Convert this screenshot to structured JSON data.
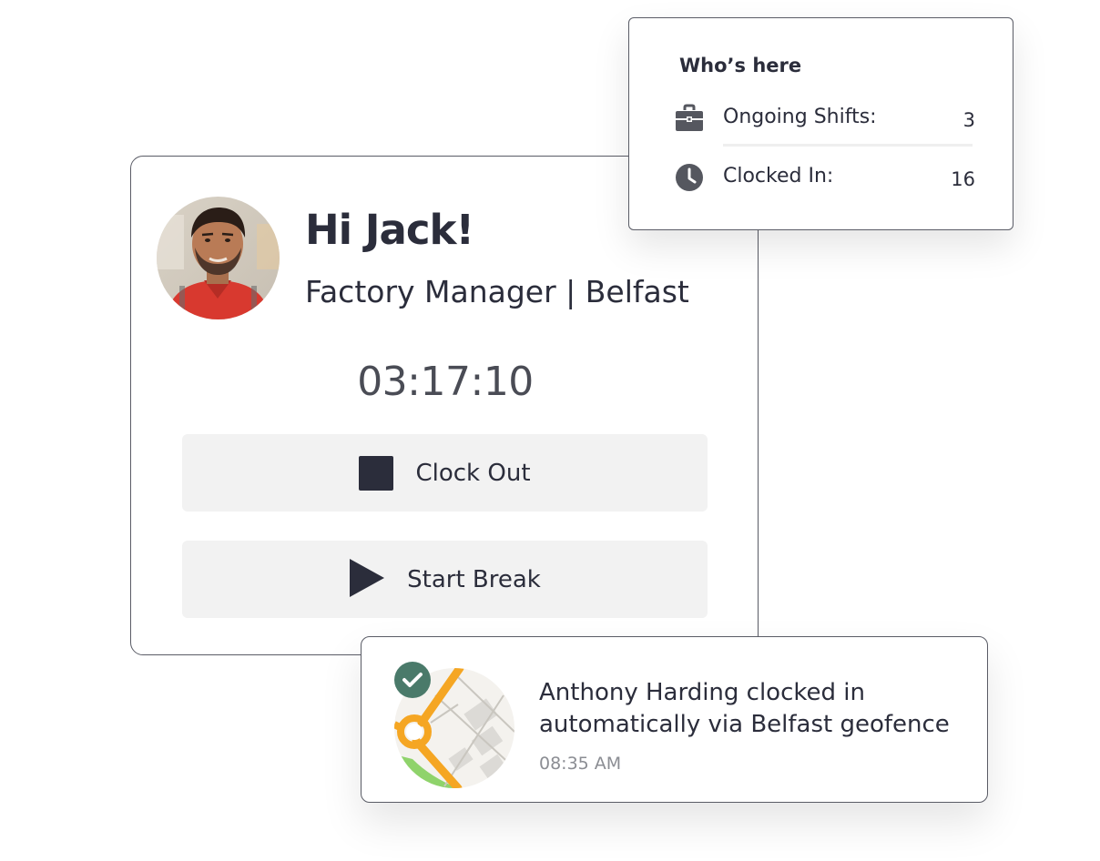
{
  "user": {
    "greeting": "Hi Jack!",
    "role_location": "Factory Manager | Belfast",
    "avatar": "user-photo"
  },
  "timer": {
    "elapsed": "03:17:10"
  },
  "actions": {
    "clock_out_label": "Clock Out",
    "clock_out_icon": "stop-icon",
    "start_break_label": "Start Break",
    "start_break_icon": "play-icon"
  },
  "whos_here": {
    "title": "Who’s here",
    "ongoing_shifts_label": "Ongoing Shifts:",
    "ongoing_shifts_icon": "briefcase-icon",
    "ongoing_shifts_value": "3",
    "clocked_in_label": "Clocked In:",
    "clocked_in_icon": "clock-icon",
    "clocked_in_value": "16"
  },
  "notification": {
    "message": "Anthony Harding clocked in automatically via Belfast geofence",
    "time": "08:35 AM",
    "thumbnail": "map-icon",
    "badge": "check-icon"
  },
  "colors": {
    "text_dark": "#2b2d3b",
    "button_bg": "#f2f2f2",
    "badge_green": "#4a7a6a",
    "map_orange": "#f5a623",
    "map_green": "#8fd36b",
    "muted_text": "#8b8d93"
  }
}
